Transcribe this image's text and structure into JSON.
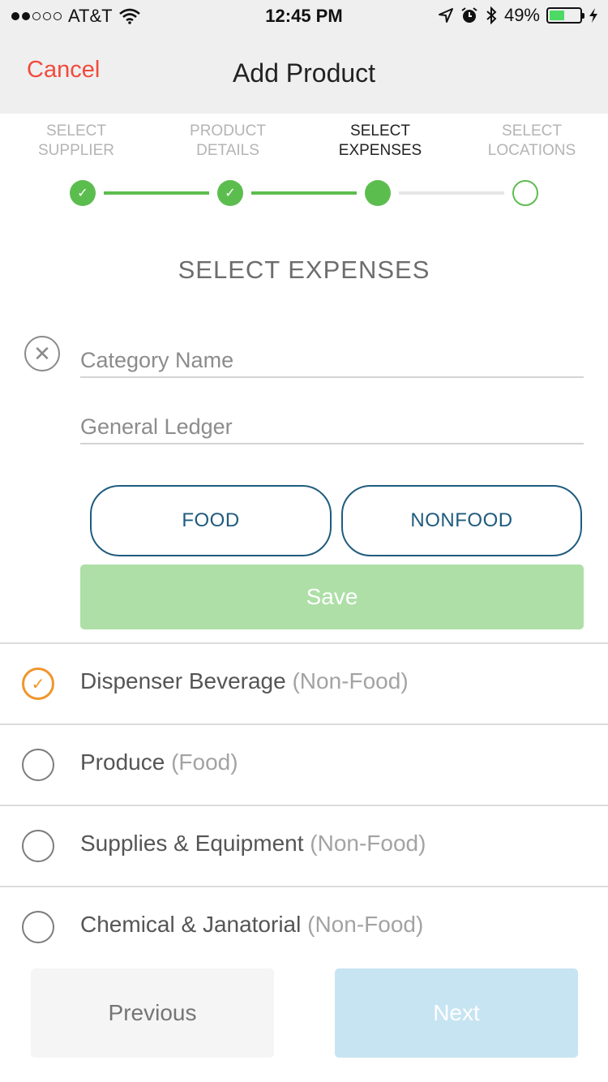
{
  "status_bar": {
    "carrier": "AT&T",
    "time": "12:45 PM",
    "battery_percent": "49%",
    "battery_level": 0.49,
    "signal_bars": 2,
    "icons": [
      "wifi-icon",
      "location-arrow-icon",
      "alarm-icon",
      "bluetooth-icon",
      "charging-bolt-icon"
    ]
  },
  "nav": {
    "cancel_label": "Cancel",
    "title": "Add Product"
  },
  "stepper": {
    "steps": [
      {
        "line1": "SELECT",
        "line2": "SUPPLIER",
        "state": "done"
      },
      {
        "line1": "PRODUCT",
        "line2": "DETAILS",
        "state": "done"
      },
      {
        "line1": "SELECT",
        "line2": "EXPENSES",
        "state": "current"
      },
      {
        "line1": "SELECT",
        "line2": "LOCATIONS",
        "state": "todo"
      }
    ],
    "check_glyph": "✓"
  },
  "form": {
    "section_title": "SELECT EXPENSES",
    "close_glyph": "✕",
    "category_name_placeholder": "Category Name",
    "general_ledger_placeholder": "General Ledger",
    "food_label": "FOOD",
    "nonfood_label": "NONFOOD",
    "save_label": "Save"
  },
  "expenses": [
    {
      "name": "Dispenser Beverage",
      "type": "(Non-Food)",
      "selected": true
    },
    {
      "name": "Produce",
      "type": "(Food)",
      "selected": false
    },
    {
      "name": "Supplies & Equipment",
      "type": "(Non-Food)",
      "selected": false
    },
    {
      "name": "Chemical & Janatorial",
      "type": "(Non-Food)",
      "selected": false
    }
  ],
  "footer": {
    "previous_label": "Previous",
    "next_label": "Next"
  },
  "colors": {
    "cancel": "#f24a3d",
    "step_green": "#5cbd4f",
    "type_button_border": "#1f5b7e",
    "save_disabled": "#addfa6",
    "selected_radio": "#f0962a",
    "next_disabled": "#c7e4f2"
  }
}
